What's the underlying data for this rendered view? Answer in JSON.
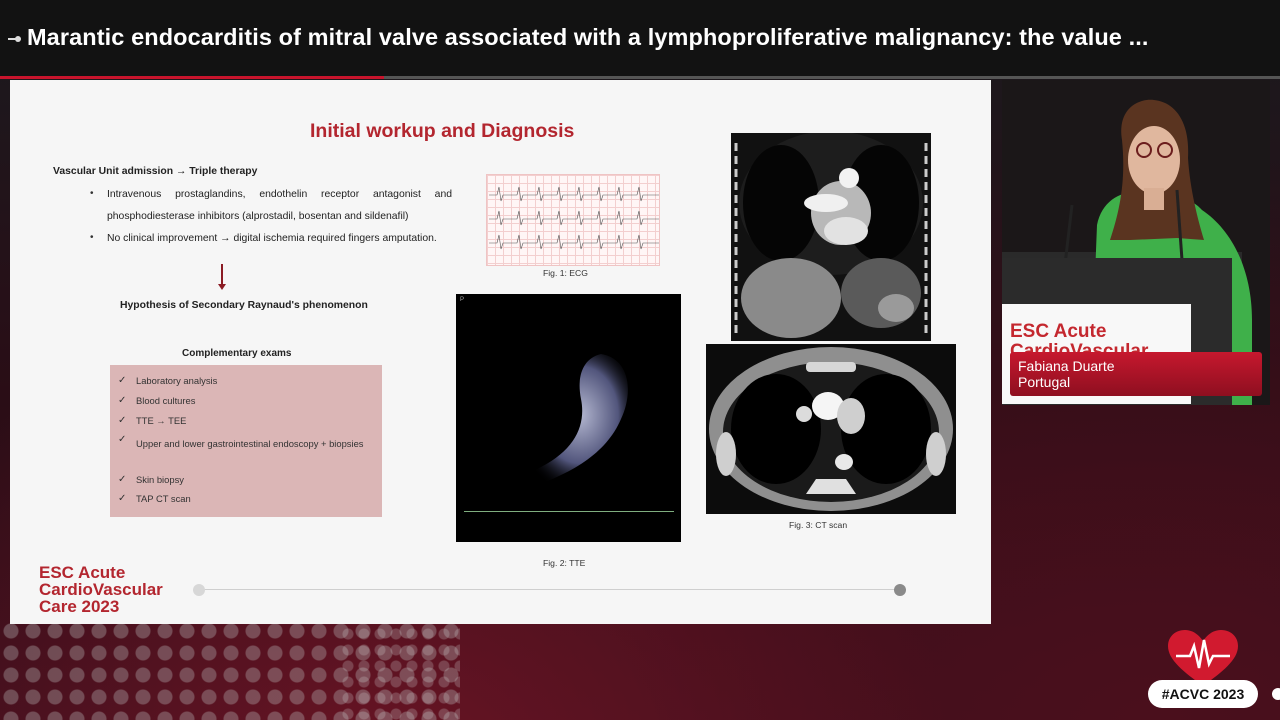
{
  "header": {
    "title": "Marantic endocarditis of mitral valve associated with a lymphoproliferative malignancy: the value ...",
    "progress_fraction": 0.3
  },
  "slide": {
    "title": "Initial workup and Diagnosis",
    "admission": "Vascular Unit admission → Triple therapy",
    "bullets": [
      "Intravenous prostaglandins, endothelin receptor antagonist and phosphodiesterase inhibitors (alprostadil, bosentan and sildenafil)",
      "No clinical improvement → digital ischemia required fingers amputation."
    ],
    "hypothesis": "Hypothesis of Secondary Raynaud's phenomenon",
    "exams_title": "Complementary exams",
    "exams": [
      "Laboratory analysis",
      "Blood cultures",
      "TTE → TEE",
      "Upper and lower gastrointestinal endoscopy + biopsies",
      "Skin biopsy",
      "TAP CT scan"
    ],
    "fig1_caption": "Fig. 1: ECG",
    "fig2_caption": "Fig. 2: TTE",
    "fig3_caption": "Fig. 3: CT scan",
    "logo": [
      "ESC Acute",
      "CardioVascular",
      "Care 2023"
    ]
  },
  "presenter": {
    "logo": [
      "ESC Acute",
      "CardioVascular"
    ],
    "name": "Fabiana Duarte",
    "country": "Portugal"
  },
  "footer": {
    "hashtag": "#ACVC 2023"
  },
  "colors": {
    "brand_red": "#b3262f",
    "nameplate_red": "#c6182e",
    "exams_box": "#dbb6b6"
  }
}
